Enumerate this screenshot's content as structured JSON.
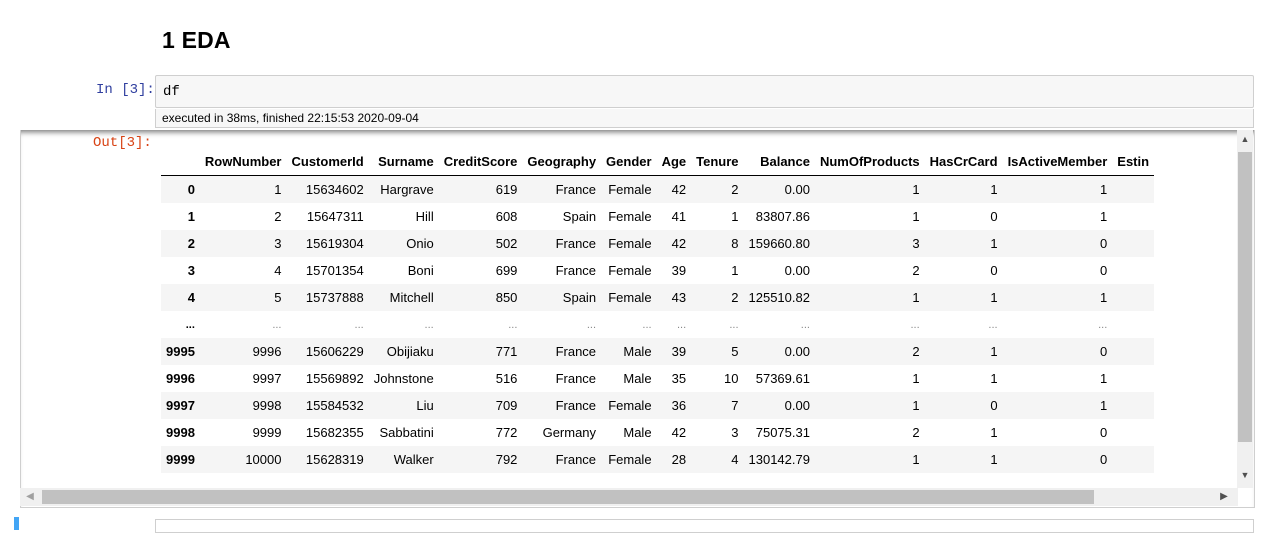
{
  "heading": "1  EDA",
  "cell": {
    "prompt_in": "In [3]:",
    "code": "df",
    "exec_info": "executed in 38ms, finished 22:15:53 2020-09-04",
    "prompt_out": "Out[3]:"
  },
  "table": {
    "columns": [
      "",
      "RowNumber",
      "CustomerId",
      "Surname",
      "CreditScore",
      "Geography",
      "Gender",
      "Age",
      "Tenure",
      "Balance",
      "NumOfProducts",
      "HasCrCard",
      "IsActiveMember",
      "Estin"
    ],
    "rows": [
      [
        "0",
        "1",
        "15634602",
        "Hargrave",
        "619",
        "France",
        "Female",
        "42",
        "2",
        "0.00",
        "1",
        "1",
        "1",
        ""
      ],
      [
        "1",
        "2",
        "15647311",
        "Hill",
        "608",
        "Spain",
        "Female",
        "41",
        "1",
        "83807.86",
        "1",
        "0",
        "1",
        ""
      ],
      [
        "2",
        "3",
        "15619304",
        "Onio",
        "502",
        "France",
        "Female",
        "42",
        "8",
        "159660.80",
        "3",
        "1",
        "0",
        ""
      ],
      [
        "3",
        "4",
        "15701354",
        "Boni",
        "699",
        "France",
        "Female",
        "39",
        "1",
        "0.00",
        "2",
        "0",
        "0",
        ""
      ],
      [
        "4",
        "5",
        "15737888",
        "Mitchell",
        "850",
        "Spain",
        "Female",
        "43",
        "2",
        "125510.82",
        "1",
        "1",
        "1",
        ""
      ],
      [
        "...",
        "...",
        "...",
        "...",
        "...",
        "...",
        "...",
        "...",
        "...",
        "...",
        "...",
        "...",
        "...",
        ""
      ],
      [
        "9995",
        "9996",
        "15606229",
        "Obijiaku",
        "771",
        "France",
        "Male",
        "39",
        "5",
        "0.00",
        "2",
        "1",
        "0",
        ""
      ],
      [
        "9996",
        "9997",
        "15569892",
        "Johnstone",
        "516",
        "France",
        "Male",
        "35",
        "10",
        "57369.61",
        "1",
        "1",
        "1",
        ""
      ],
      [
        "9997",
        "9998",
        "15584532",
        "Liu",
        "709",
        "France",
        "Female",
        "36",
        "7",
        "0.00",
        "1",
        "0",
        "1",
        ""
      ],
      [
        "9998",
        "9999",
        "15682355",
        "Sabbatini",
        "772",
        "Germany",
        "Male",
        "42",
        "3",
        "75075.31",
        "2",
        "1",
        "0",
        ""
      ],
      [
        "9999",
        "10000",
        "15628319",
        "Walker",
        "792",
        "France",
        "Female",
        "28",
        "4",
        "130142.79",
        "1",
        "1",
        "0",
        ""
      ]
    ]
  },
  "scrollbars": {
    "up_icon": "▲",
    "down_icon": "▼",
    "left_icon": "◀",
    "right_icon": "▶"
  }
}
